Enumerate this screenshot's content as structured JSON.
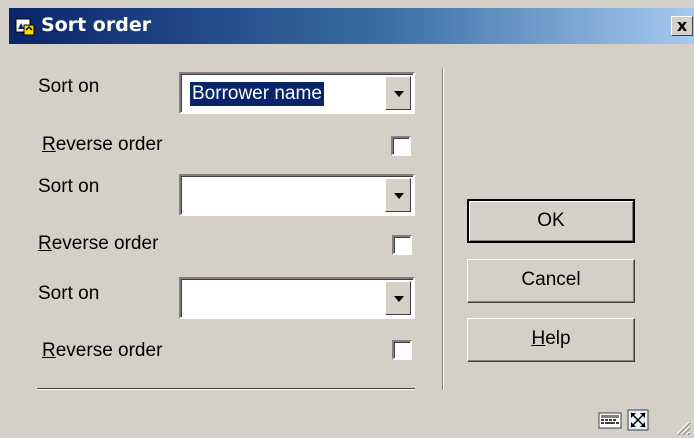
{
  "window": {
    "title": "Sort order",
    "close_label": "x"
  },
  "sort_rows": [
    {
      "sort_label": "Sort on",
      "sort_value": "Borrower name",
      "reverse_label_prefix": "R",
      "reverse_label_rest": "everse order",
      "reverse_checked": false
    },
    {
      "sort_label": "Sort on",
      "sort_value": "",
      "reverse_label_prefix": "R",
      "reverse_label_rest": "everse order",
      "reverse_checked": false
    },
    {
      "sort_label": "Sort on",
      "sort_value": "",
      "reverse_label_prefix": "R",
      "reverse_label_rest": "everse order",
      "reverse_checked": false
    }
  ],
  "buttons": {
    "ok_label": "OK",
    "cancel_label": "Cancel",
    "help_prefix": "H",
    "help_rest": "elp"
  },
  "status_icons": [
    "keyboard-icon",
    "resize-icon",
    "size-grip-icon"
  ]
}
